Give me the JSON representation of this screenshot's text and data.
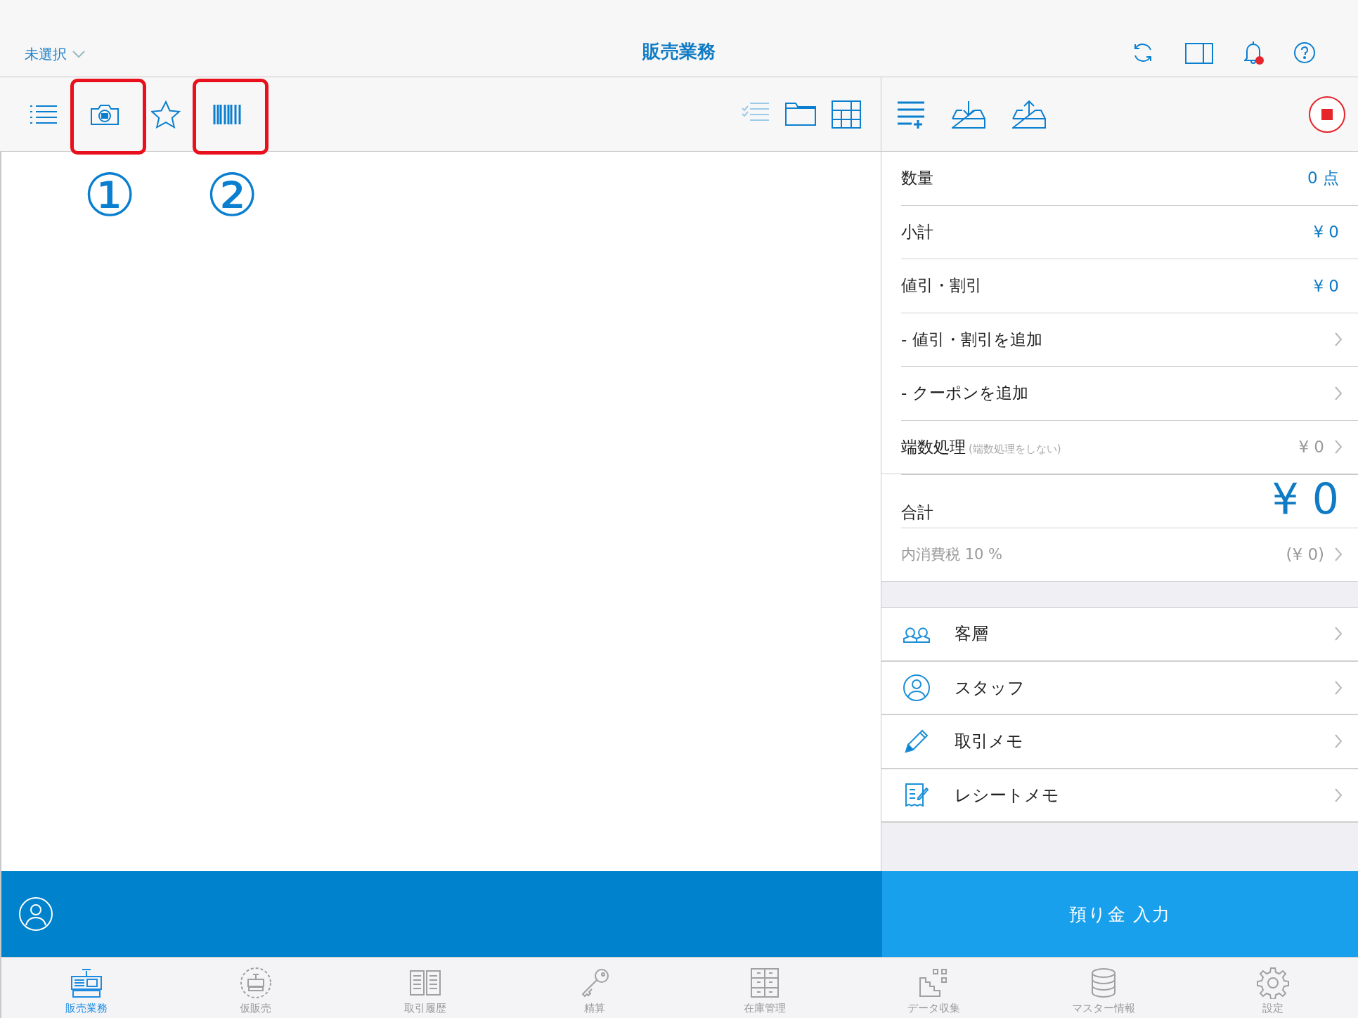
{
  "header": {
    "store_selector": "未選択",
    "title": "販売業務",
    "actions": [
      {
        "kind": "refresh"
      },
      {
        "kind": "sidebar"
      },
      {
        "kind": "bell",
        "badge": true
      },
      {
        "kind": "help"
      }
    ]
  },
  "toolbar": {
    "left_tools": [
      {
        "kind": "list",
        "highlighted": false
      },
      {
        "kind": "camera",
        "highlighted": true,
        "callout": "①"
      },
      {
        "kind": "star",
        "highlighted": false
      },
      {
        "kind": "barcode",
        "highlighted": true,
        "callout": "②"
      }
    ],
    "right_tools": [
      {
        "kind": "checklist",
        "disabled": true
      },
      {
        "kind": "folder",
        "disabled": false
      },
      {
        "kind": "grid",
        "disabled": false
      }
    ],
    "cart_tools": [
      {
        "kind": "list-add"
      },
      {
        "kind": "tray-in"
      },
      {
        "kind": "tray-out"
      }
    ],
    "stop": {
      "kind": "stop"
    }
  },
  "summary_rows": [
    {
      "kind": "amount",
      "label": "数量",
      "value": "0 点"
    },
    {
      "kind": "amount",
      "label": "小計",
      "value": "¥ 0"
    },
    {
      "kind": "amount",
      "label": "値引・割引",
      "value": "¥ 0"
    },
    {
      "kind": "action",
      "label": "- 値引・割引を追加"
    },
    {
      "kind": "action",
      "label": "- クーポンを追加"
    },
    {
      "kind": "adjust",
      "label": "端数処理",
      "note": "(端数処理をしない)",
      "value": "¥ 0"
    },
    {
      "kind": "total",
      "label": "合計",
      "value": "¥ 0"
    },
    {
      "kind": "tax",
      "label": "内消費税 10 %",
      "value": "(¥ 0)"
    }
  ],
  "menu_items": [
    {
      "kind": "customers",
      "label": "客層"
    },
    {
      "kind": "staff",
      "label": "スタッフ"
    },
    {
      "kind": "pencil",
      "label": "取引メモ"
    },
    {
      "kind": "receipt",
      "label": "レシートメモ"
    }
  ],
  "checkout_button": "預り金 入力",
  "tab_bar": [
    {
      "kind": "register",
      "label": "販売業務",
      "selected": true
    },
    {
      "kind": "temp-register",
      "label": "仮販売",
      "selected": false
    },
    {
      "kind": "book",
      "label": "取引履歴",
      "selected": false
    },
    {
      "kind": "key",
      "label": "精算",
      "selected": false
    },
    {
      "kind": "cabinet",
      "label": "在庫管理",
      "selected": false
    },
    {
      "kind": "data",
      "label": "データ収集",
      "selected": false
    },
    {
      "kind": "database",
      "label": "マスター情報",
      "selected": false
    },
    {
      "kind": "gear",
      "label": "設定",
      "selected": false
    }
  ]
}
